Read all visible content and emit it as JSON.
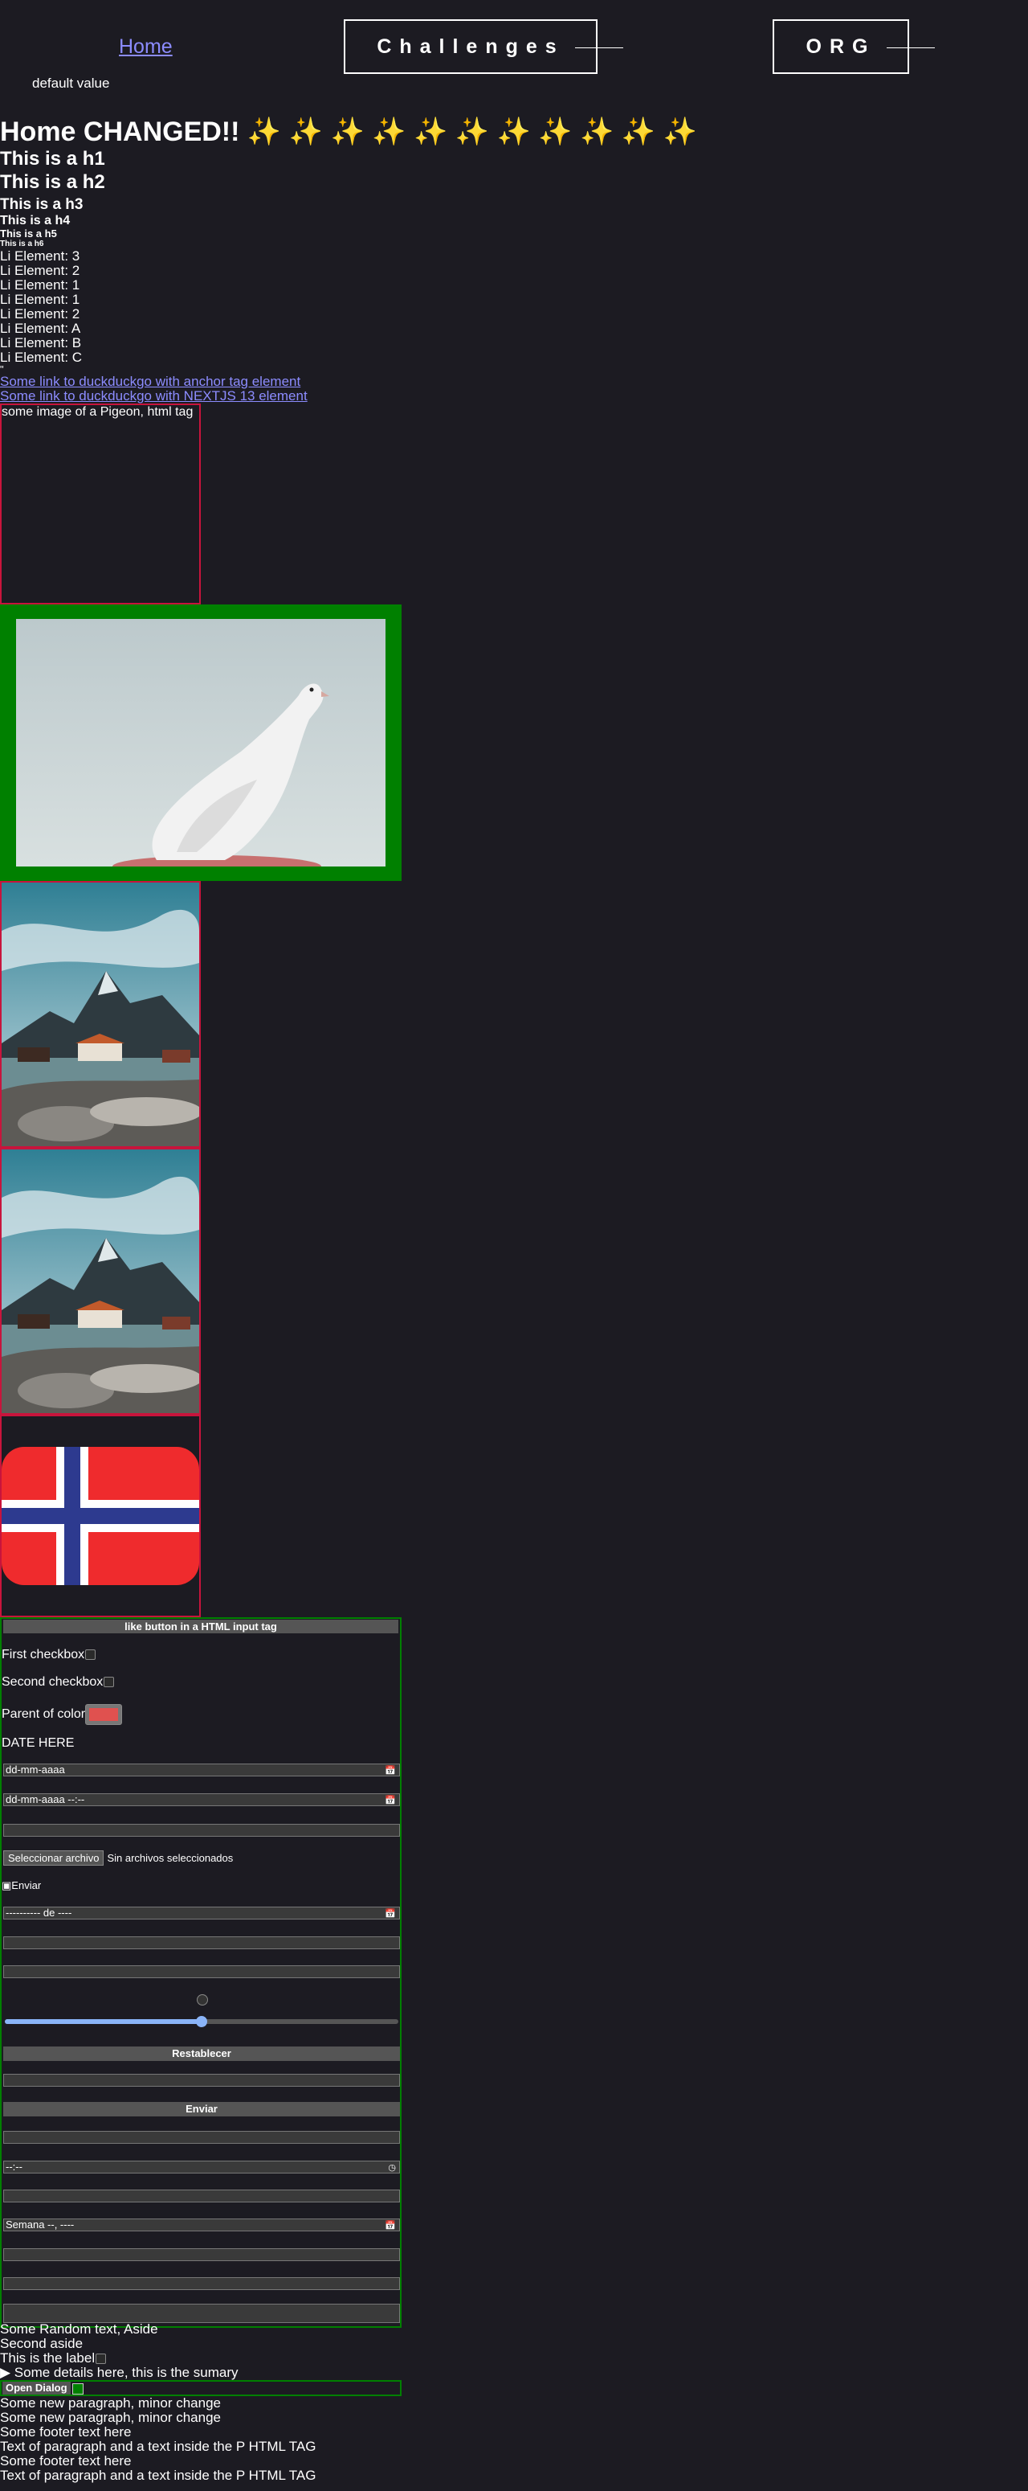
{
  "nav": {
    "home_label": "Home",
    "challenges_label": "Challenges",
    "org_label": "ORG"
  },
  "default_value_text": "default value",
  "headings": {
    "main": "Home CHANGED!! ✨ ✨ ✨ ✨ ✨ ✨ ✨ ✨ ✨ ✨ ✨",
    "h1": "This is a h1",
    "h2": "This is a h2",
    "h3": "This is a h3",
    "h4": "This is a h4",
    "h5": "This is a h5",
    "h6": "This is a h6"
  },
  "list_items": [
    "Li Element: 3",
    "Li Element: 2",
    "Li Element: 1",
    "Li Element: 1",
    "Li Element: 2",
    "Li Element: A",
    "Li Element: B",
    "Li Element: C"
  ],
  "quote_mark": "\"",
  "links": {
    "anchor": "Some link to duckduckgo with anchor tag element",
    "nextjs": "Some link to duckduckgo with NEXTJS 13 element"
  },
  "broken_image_alt": "some image of a Pigeon, html tag",
  "form": {
    "input_button_label": "like button in a HTML input tag",
    "first_checkbox_label": "First checkbox",
    "second_checkbox_label": "Second checkbox",
    "color_label": "Parent of color",
    "color_value": "#e0514f",
    "date_heading": "DATE HERE",
    "date_placeholder": "dd-mm-aaaa",
    "datetime_placeholder": "dd-mm-aaaa --:--",
    "file_button": "Seleccionar archivo",
    "file_status": "Sin archivos seleccionados",
    "image_submit_alt": "Enviar",
    "month_placeholder": "---------- de ----",
    "range_value": 0.5,
    "reset_label": "Restablecer",
    "submit_label": "Enviar",
    "time_placeholder": "--:--",
    "week_placeholder": "Semana --, ----"
  },
  "footer": {
    "aside_1": "Some Random text, Aside",
    "aside_2": "Second aside",
    "label_text": "This is the label",
    "details_summary": "▶  Some details here, this is the sumary",
    "dialog_button": "Open Dialog",
    "paragraph_1": "Some new paragraph, minor change",
    "paragraph_2": "Some new paragraph, minor change",
    "footer_1": "Some footer text here",
    "p_tag_1": "Text of paragraph and a text inside the P HTML TAG",
    "footer_2": "Some footer text here",
    "p_tag_2": "Text of paragraph and a text inside the P HTML TAG"
  },
  "colors": {
    "background": "#1c1b22",
    "link": "#8c8cff",
    "frame_red": "#c8143c",
    "frame_green": "#008000"
  }
}
